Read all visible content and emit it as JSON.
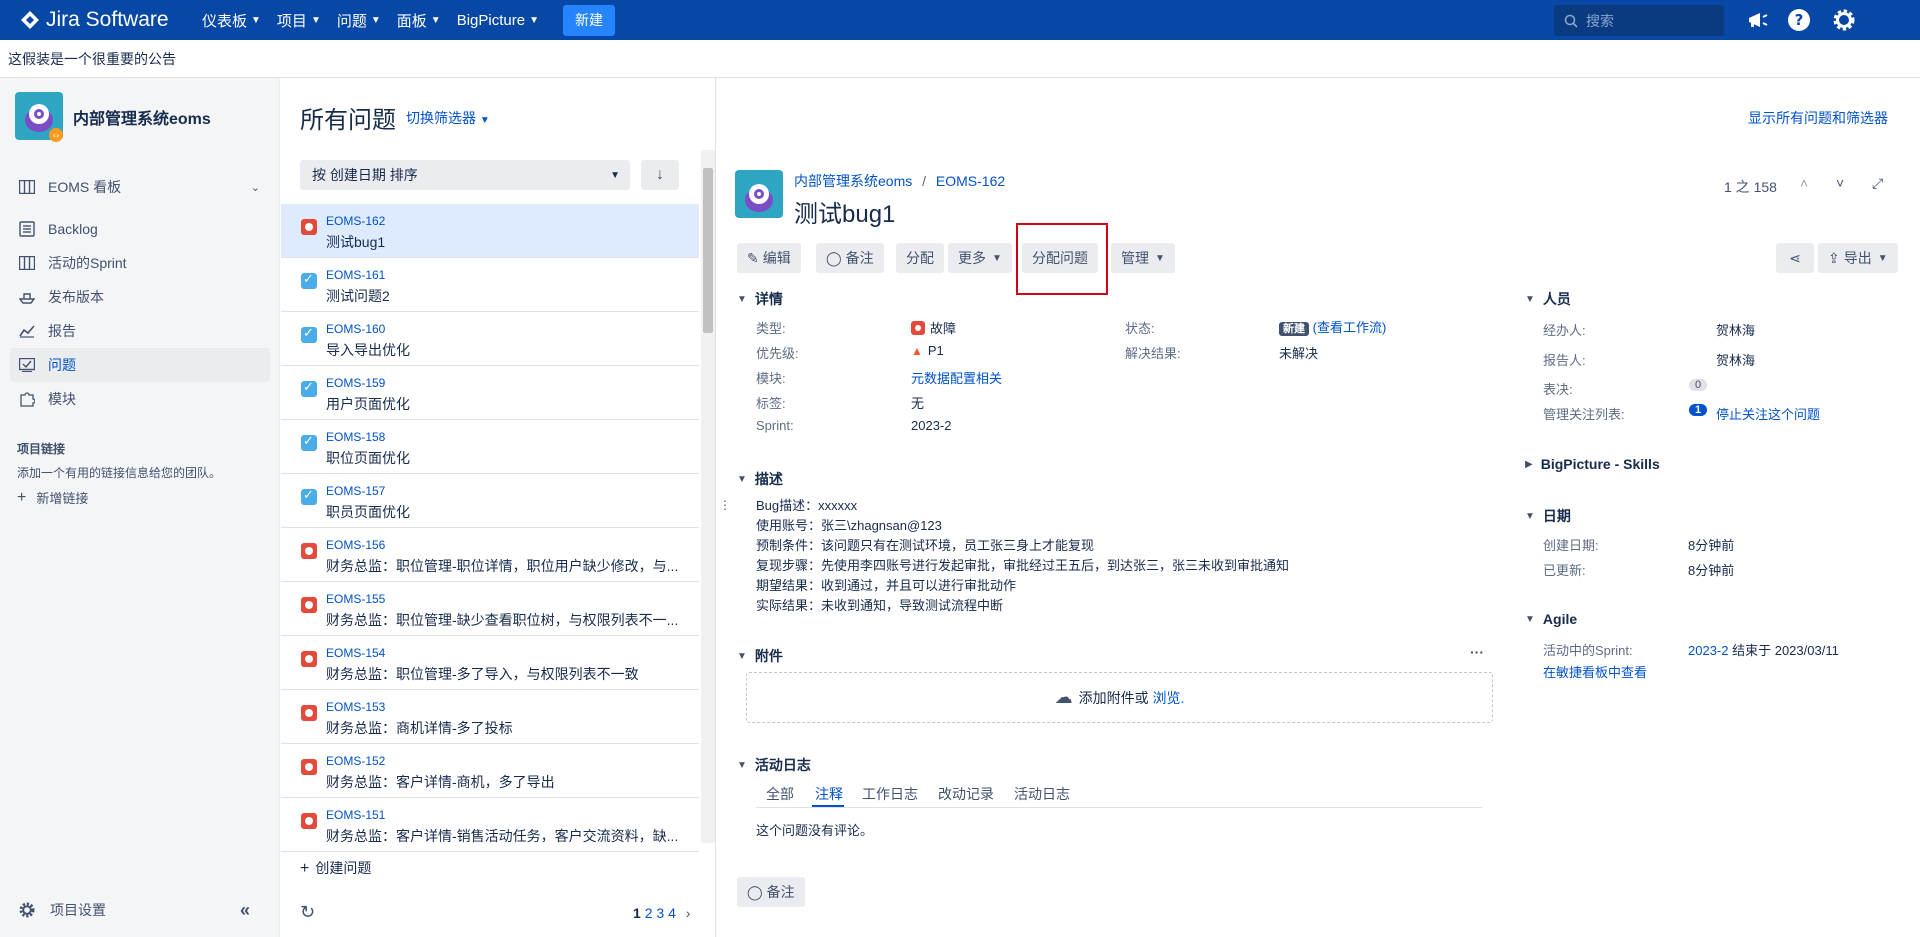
{
  "topnav": {
    "brand": "Jira Software",
    "menu": [
      "仪表板",
      "项目",
      "问题",
      "面板",
      "BigPicture"
    ],
    "create": "新建",
    "search_placeholder": "搜索"
  },
  "banner": "这假装是一个很重要的公告",
  "sidebar": {
    "project_name": "内部管理系统eoms",
    "board": "EOMS 看板",
    "items": [
      "Backlog",
      "活动的Sprint",
      "发布版本",
      "报告",
      "问题",
      "模块"
    ],
    "links_title": "项目链接",
    "links_desc": "添加一个有用的链接信息给您的团队。",
    "add_link": "新增链接",
    "settings": "项目设置"
  },
  "list": {
    "title": "所有问题",
    "switch_filter": "切换筛选器",
    "show_all": "显示所有问题和筛选器",
    "sort_label": "按 创建日期 排序",
    "create_issue": "创建问题",
    "pages": [
      "1",
      "2",
      "3",
      "4"
    ],
    "issues": [
      {
        "key": "EOMS-162",
        "summary": "测试bug1",
        "type": "bug"
      },
      {
        "key": "EOMS-161",
        "summary": "测试问题2",
        "type": "task"
      },
      {
        "key": "EOMS-160",
        "summary": "导入导出优化",
        "type": "task"
      },
      {
        "key": "EOMS-159",
        "summary": "用户页面优化",
        "type": "task"
      },
      {
        "key": "EOMS-158",
        "summary": "职位页面优化",
        "type": "task"
      },
      {
        "key": "EOMS-157",
        "summary": "职员页面优化",
        "type": "task"
      },
      {
        "key": "EOMS-156",
        "summary": "财务总监：职位管理-职位详情，职位用户缺少修改，与...",
        "type": "bug"
      },
      {
        "key": "EOMS-155",
        "summary": "财务总监：职位管理-缺少查看职位树，与权限列表不一...",
        "type": "bug"
      },
      {
        "key": "EOMS-154",
        "summary": "财务总监：职位管理-多了导入，与权限列表不一致",
        "type": "bug"
      },
      {
        "key": "EOMS-153",
        "summary": "财务总监：商机详情-多了投标",
        "type": "bug"
      },
      {
        "key": "EOMS-152",
        "summary": "财务总监：客户详情-商机，多了导出",
        "type": "bug"
      },
      {
        "key": "EOMS-151",
        "summary": "财务总监：客户详情-销售活动任务，客户交流资料，缺...",
        "type": "bug"
      }
    ]
  },
  "detail": {
    "breadcrumb_project": "内部管理系统eoms",
    "breadcrumb_key": "EOMS-162",
    "title": "测试bug1",
    "position": "1 之 158",
    "buttons": {
      "edit": "编辑",
      "comment": "备注",
      "assign": "分配",
      "more": "更多",
      "assign_issue": "分配问题",
      "manage": "管理",
      "export": "导出"
    },
    "details_title": "详情",
    "fields": {
      "type_label": "类型:",
      "type": "故障",
      "priority_label": "优先级:",
      "priority": "P1",
      "component_label": "模块:",
      "component": "元数据配置相关",
      "labels_label": "标签:",
      "labels": "无",
      "sprint_label": "Sprint:",
      "sprint": "2023-2",
      "status_label": "状态:",
      "status": "新建",
      "workflow": "(查看工作流)",
      "resolution_label": "解决结果:",
      "resolution": "未解决"
    },
    "description_title": "描述",
    "description": [
      "Bug描述：xxxxxx",
      "使用账号：张三\\zhagnsan@123",
      "预制条件：该问题只有在测试环境，员工张三身上才能复现",
      "复现步骤：先使用李四账号进行发起审批，审批经过王五后，到达张三，张三未收到审批通知",
      "期望结果：收到通过，并且可以进行审批动作",
      "实际结果：未收到通知，导致测试流程中断"
    ],
    "attachments_title": "附件",
    "attach_text": "添加附件或",
    "attach_link": "浏览.",
    "activity_title": "活动日志",
    "tabs": [
      "全部",
      "注释",
      "工作日志",
      "改动记录",
      "活动日志"
    ],
    "no_comments": "这个问题没有评论。",
    "comment_btn": "备注"
  },
  "people": {
    "title": "人员",
    "assignee_label": "经办人:",
    "assignee": "贺林海",
    "reporter_label": "报告人:",
    "reporter": "贺林海",
    "votes_label": "表决:",
    "votes": "0",
    "watchers_label": "管理关注列表:",
    "watchers": "1",
    "stop_watch": "停止关注这个问题",
    "bigpicture": "BigPicture - Skills",
    "dates_title": "日期",
    "created_label": "创建日期:",
    "created": "8分钟前",
    "updated_label": "已更新:",
    "updated": "8分钟前",
    "agile_title": "Agile",
    "active_sprint_label": "活动中的Sprint:",
    "active_sprint": "2023-2",
    "sprint_end": "结束于 2023/03/11",
    "view_board": "在敏捷看板中查看"
  },
  "colors": {
    "topnav": "#0747a6",
    "link": "#0052cc",
    "bug": "#e5493a",
    "task": "#4bade8",
    "highlight": "#d0021b"
  }
}
